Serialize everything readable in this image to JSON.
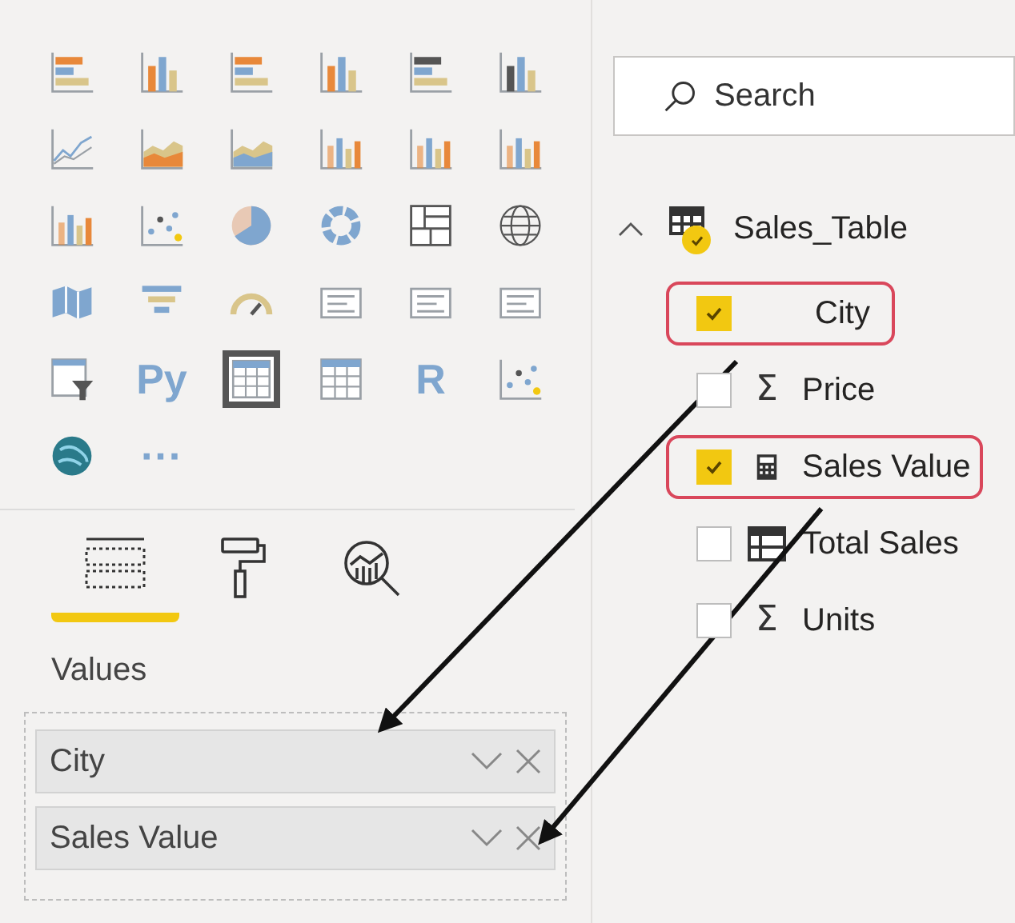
{
  "visualizations": [
    {
      "kind": "bar",
      "selected": false
    },
    {
      "kind": "column",
      "selected": false
    },
    {
      "kind": "bar",
      "selected": false
    },
    {
      "kind": "column",
      "selected": false
    },
    {
      "kind": "bar",
      "selected": false
    },
    {
      "kind": "column",
      "selected": false
    },
    {
      "kind": "line",
      "selected": false
    },
    {
      "kind": "area",
      "selected": false
    },
    {
      "kind": "area",
      "selected": false
    },
    {
      "kind": "combo",
      "selected": false
    },
    {
      "kind": "combo",
      "selected": false
    },
    {
      "kind": "combo",
      "selected": false
    },
    {
      "kind": "combo",
      "selected": false
    },
    {
      "kind": "scatter",
      "selected": false
    },
    {
      "kind": "pie",
      "selected": false
    },
    {
      "kind": "donut",
      "selected": false
    },
    {
      "kind": "treemap",
      "selected": false
    },
    {
      "kind": "globe",
      "selected": false
    },
    {
      "kind": "map",
      "selected": false
    },
    {
      "kind": "funnel",
      "selected": false
    },
    {
      "kind": "gauge",
      "selected": false
    },
    {
      "kind": "card",
      "selected": false
    },
    {
      "kind": "card",
      "selected": false
    },
    {
      "kind": "card",
      "selected": false
    },
    {
      "kind": "slicer",
      "selected": false
    },
    {
      "kind": "text",
      "label": "Py",
      "selected": false
    },
    {
      "kind": "table",
      "selected": true
    },
    {
      "kind": "table",
      "selected": false
    },
    {
      "kind": "text",
      "label": "R",
      "selected": false
    },
    {
      "kind": "scatter",
      "selected": false
    },
    {
      "kind": "earth",
      "selected": false
    },
    {
      "kind": "text",
      "label": "···",
      "selected": false
    }
  ],
  "pane_tabs": [
    {
      "kind": "fields",
      "selected": true
    },
    {
      "kind": "format",
      "selected": false
    },
    {
      "kind": "analytics",
      "selected": false
    }
  ],
  "well": {
    "label": "Values",
    "items": [
      "City",
      "Sales Value"
    ]
  },
  "search": {
    "placeholder": "Search"
  },
  "table": {
    "name": "Sales_Table",
    "expanded": true,
    "checked": true,
    "fields": [
      {
        "name": "City",
        "kind": "text",
        "checked": true,
        "highlighted": true
      },
      {
        "name": "Price",
        "kind": "sum",
        "icon": "Σ",
        "checked": false,
        "highlighted": false
      },
      {
        "name": "Sales Value",
        "kind": "measure",
        "checked": true,
        "highlighted": true
      },
      {
        "name": "Total Sales",
        "kind": "table",
        "checked": false,
        "highlighted": false
      },
      {
        "name": "Units",
        "kind": "sum",
        "icon": "Σ",
        "checked": false,
        "highlighted": false
      }
    ]
  }
}
